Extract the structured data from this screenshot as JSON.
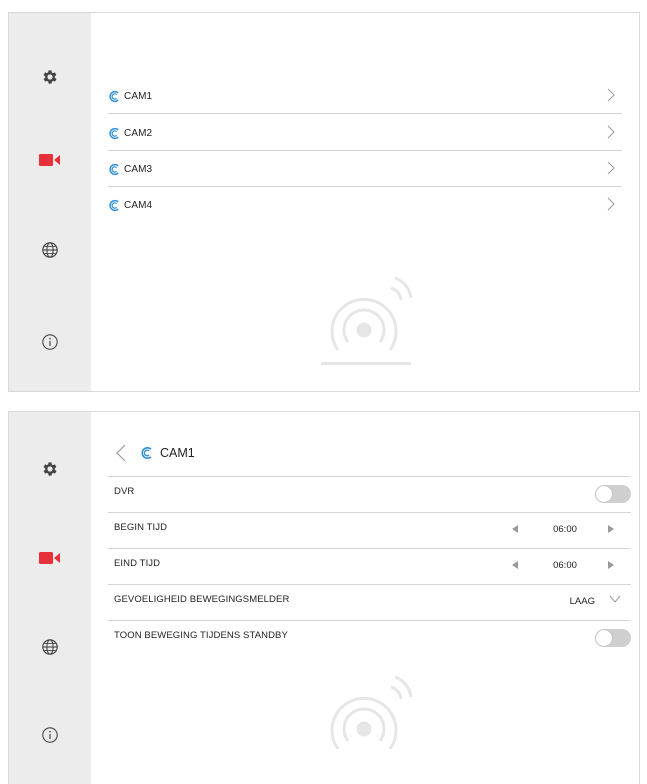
{
  "colors": {
    "accent_red": "#e8303a",
    "cam_blue": "#2f8fd6",
    "icon_gray": "#444444",
    "sidebar_bg": "#ececec"
  },
  "sidebar": {
    "items": [
      {
        "icon": "gear-icon"
      },
      {
        "icon": "video-camera-icon"
      },
      {
        "icon": "globe-icon"
      },
      {
        "icon": "info-icon"
      }
    ]
  },
  "camera_list": {
    "items": [
      {
        "label": "CAM1"
      },
      {
        "label": "CAM2"
      },
      {
        "label": "CAM3"
      },
      {
        "label": "CAM4"
      }
    ]
  },
  "cam_settings": {
    "title": "CAM1",
    "dvr_label": "DVR",
    "dvr_enabled": false,
    "begin_label": "BEGIN TIJD",
    "begin_value": "06:00",
    "end_label": "EIND TIJD",
    "end_value": "06:00",
    "sensitivity_label": "GEVOELIGHEID BEWEGINGSMELDER",
    "sensitivity_value": "LAAG",
    "standby_label": "TOON BEWEGING TIJDENS STANDBY",
    "standby_enabled": false
  }
}
